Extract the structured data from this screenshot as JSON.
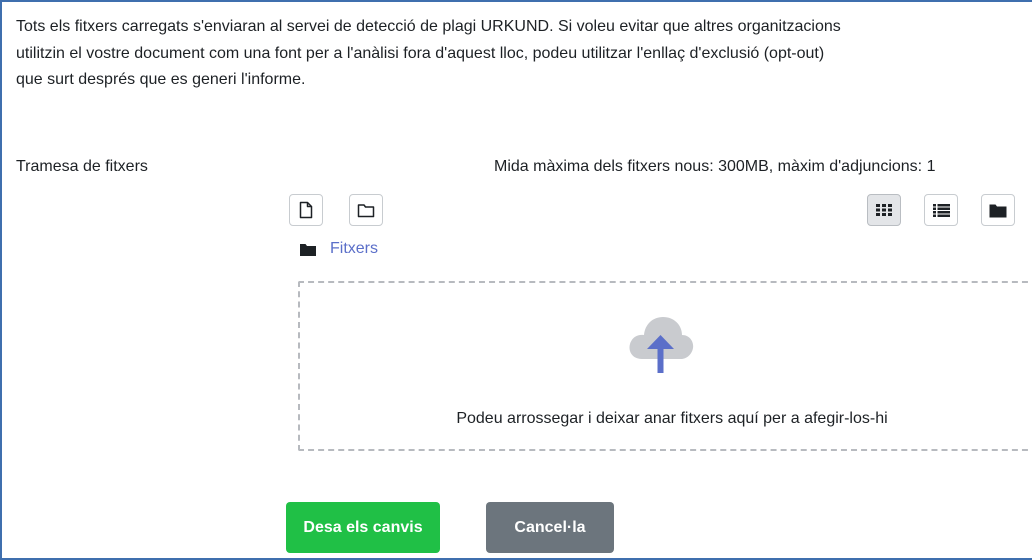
{
  "notice": {
    "line1": "Tots els fitxers carregats s'enviaran al servei de detecció de plagi URKUND. Si voleu evitar que altres organitzacions",
    "line2": "utilitzin el vostre document com una font per a l'anàlisi fora d'aquest lloc, podeu utilitzar l'enllaç d'exclusió (opt-out)",
    "line3": "que surt després que es generi l'informe."
  },
  "field": {
    "label": "Tramesa de fitxers",
    "max_info": "Mida màxima dels fitxers nous: 300MB, màxim d'adjuncions: 1"
  },
  "toolbar": {
    "left_icons": [
      "add-file-icon",
      "create-folder-icon"
    ],
    "view_icons": [
      "grid-view-icon",
      "list-view-icon",
      "tree-view-icon"
    ],
    "active_view": "grid-view-icon"
  },
  "breadcrumb": {
    "icon": "folder-icon",
    "label": "Fitxers"
  },
  "dropzone": {
    "icon": "cloud-upload-icon",
    "message": "Podeu arrossegar i deixar anar fitxers aquí per a afegir-los-hi"
  },
  "buttons": {
    "save": "Desa els canvis",
    "cancel": "Cancel·la"
  },
  "colors": {
    "save": "#20c046",
    "cancel": "#6c757d",
    "link": "#5b6fc9",
    "upload_arrow": "#5b6fc9",
    "cloud": "#c9cbcf",
    "frame_border": "#3f6fae"
  }
}
